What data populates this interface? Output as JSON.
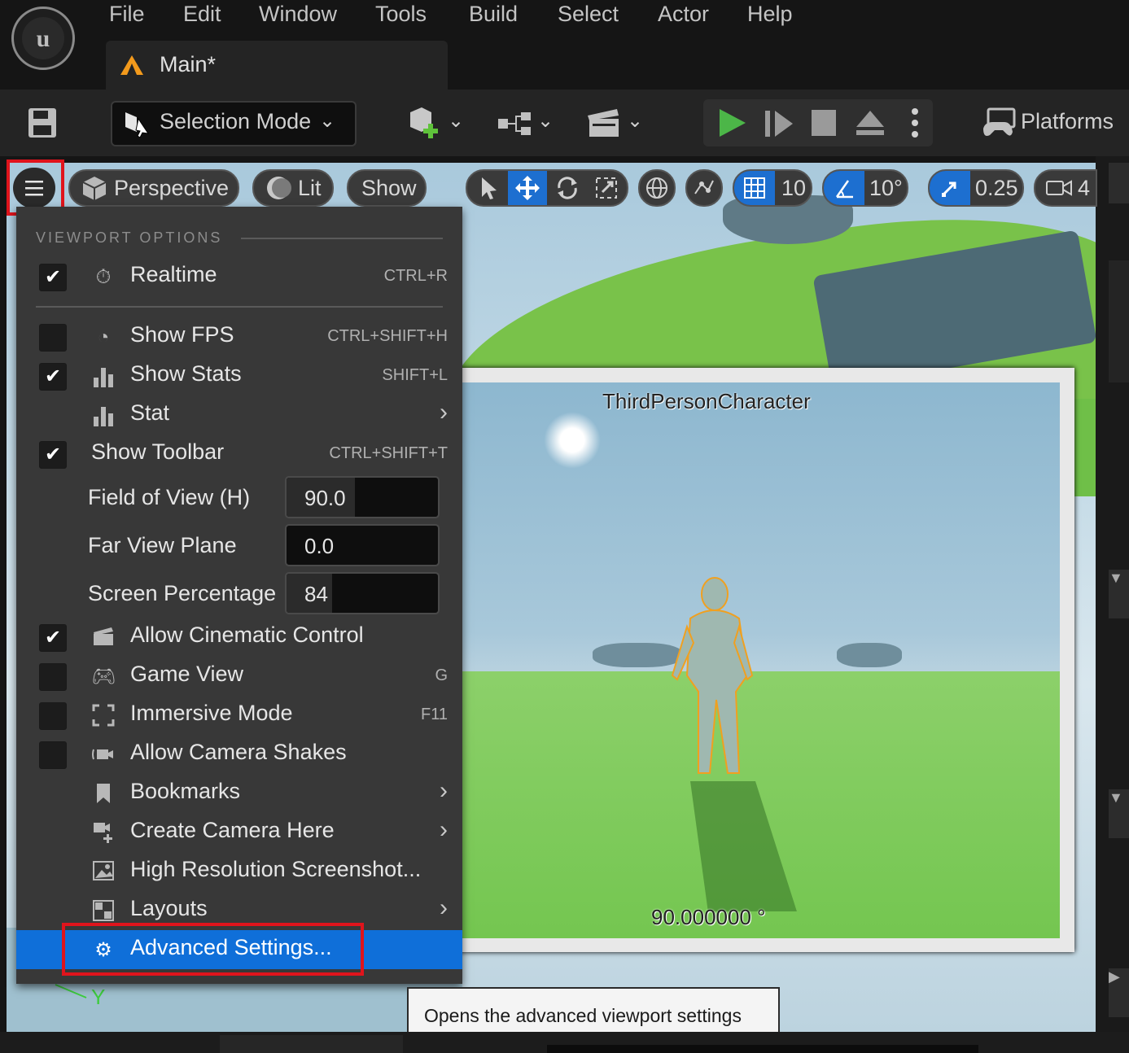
{
  "menubar": {
    "items": [
      "File",
      "Edit",
      "Window",
      "Tools",
      "Build",
      "Select",
      "Actor",
      "Help"
    ],
    "tab_label": "Main*"
  },
  "toolbar": {
    "selection_mode": "Selection Mode",
    "platforms": "Platforms"
  },
  "viewport_toolbar": {
    "perspective": "Perspective",
    "lit": "Lit",
    "show": "Show",
    "grid_snap": "10",
    "rotation_snap": "10°",
    "scale_snap": "0.25",
    "camera_speed": "4"
  },
  "viewport_options": {
    "header": "VIEWPORT OPTIONS",
    "realtime": {
      "label": "Realtime",
      "shortcut": "CTRL+R",
      "checked": true
    },
    "show_fps": {
      "label": "Show FPS",
      "shortcut": "CTRL+SHIFT+H",
      "checked": false
    },
    "show_stats": {
      "label": "Show Stats",
      "shortcut": "SHIFT+L",
      "checked": true
    },
    "stat": {
      "label": "Stat"
    },
    "show_toolbar": {
      "label": "Show Toolbar",
      "shortcut": "CTRL+SHIFT+T",
      "checked": true
    },
    "field_of_view": {
      "label": "Field of View (H)",
      "value": "90.0",
      "fill": 0.45
    },
    "far_view_plane": {
      "label": "Far View Plane",
      "value": "0.0",
      "fill": 0.0
    },
    "screen_percentage": {
      "label": "Screen Percentage",
      "value": "84",
      "fill": 0.3
    },
    "allow_cinematic_control": {
      "label": "Allow Cinematic Control",
      "checked": true
    },
    "game_view": {
      "label": "Game View",
      "shortcut": "G",
      "checked": false
    },
    "immersive_mode": {
      "label": "Immersive Mode",
      "shortcut": "F11",
      "checked": false
    },
    "allow_camera_shakes": {
      "label": "Allow Camera Shakes",
      "checked": false
    },
    "bookmarks": {
      "label": "Bookmarks"
    },
    "create_camera_here": {
      "label": "Create Camera Here"
    },
    "high_res_screenshot": {
      "label": "High Resolution Screenshot..."
    },
    "layouts": {
      "label": "Layouts"
    },
    "advanced_settings": {
      "label": "Advanced Settings..."
    }
  },
  "pip": {
    "title": "ThirdPersonCharacter",
    "angle": "90.000000 °"
  },
  "axis_label": "Y",
  "tooltip": "Opens the advanced viewport settings",
  "colors": {
    "accent": "#0f6fd9",
    "highlight_box": "#e0141c",
    "play_green": "#4cb648"
  }
}
